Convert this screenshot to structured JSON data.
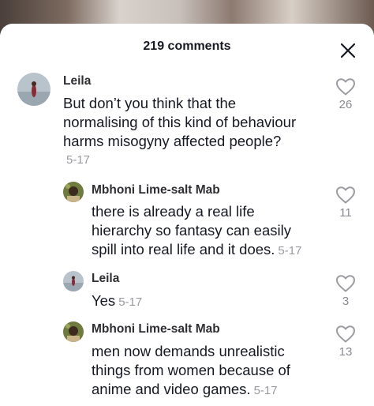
{
  "header": {
    "title": "219 comments"
  },
  "comments": [
    {
      "author": "Leila",
      "lines": [
        "But don’t you think that the",
        "normalising of this kind of behaviour",
        "harms misogyny affected people?"
      ],
      "timestamp": "5-17",
      "likes": "26",
      "avatar": "avatar-leila"
    },
    {
      "author": "Mbhoni Lime-salt Mab",
      "lines": [
        "there is already a real life",
        "hierarchy so fantasy can easily",
        "spill into real life and it does."
      ],
      "timestamp": "5-17",
      "likes": "11",
      "avatar": "avatar-mbhoni"
    },
    {
      "author": "Leila",
      "lines": [
        "Yes"
      ],
      "timestamp": "5-17",
      "likes": "3",
      "avatar": "avatar-leila"
    },
    {
      "author": "Mbhoni Lime-salt Mab",
      "lines": [
        "men now demands unrealistic",
        "things from women because of",
        "anime and video games."
      ],
      "timestamp": "5-17",
      "likes": "13",
      "avatar": "avatar-mbhoni"
    }
  ],
  "icons": {
    "close": "close-icon",
    "like": "heart-outline-icon"
  },
  "colors": {
    "text": "#161823",
    "secondary": "#9a9aa0",
    "icon": "#9b9ba1"
  }
}
